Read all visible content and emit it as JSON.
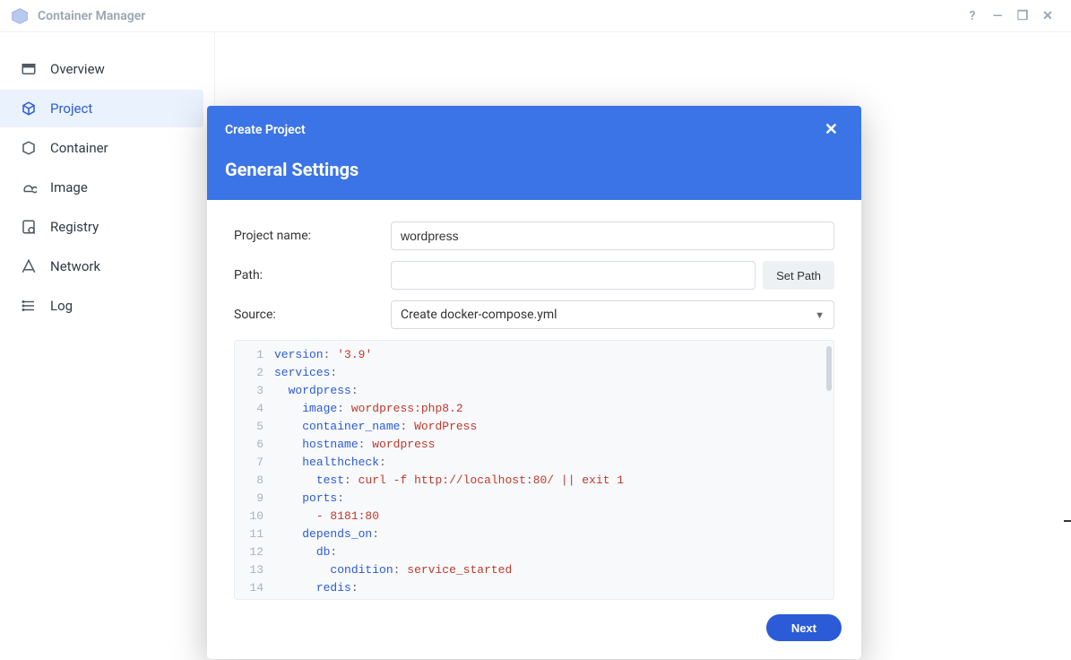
{
  "app": {
    "title": "Container Manager"
  },
  "window_controls": {
    "help": "?",
    "minimize": "—",
    "maximize": "❐",
    "close": "✕"
  },
  "sidebar": {
    "items": [
      {
        "id": "overview",
        "label": "Overview"
      },
      {
        "id": "project",
        "label": "Project",
        "active": true
      },
      {
        "id": "container",
        "label": "Container"
      },
      {
        "id": "image",
        "label": "Image"
      },
      {
        "id": "registry",
        "label": "Registry"
      },
      {
        "id": "network",
        "label": "Network"
      },
      {
        "id": "log",
        "label": "Log"
      }
    ]
  },
  "modal": {
    "title": "Create Project",
    "section": "General Settings",
    "labels": {
      "projectName": "Project name:",
      "path": "Path:",
      "source": "Source:",
      "setPath": "Set Path",
      "next": "Next"
    },
    "projectName": "wordpress",
    "path": "",
    "sourceSelected": "Create docker-compose.yml",
    "code": [
      {
        "indent": 0,
        "key": "version",
        "val": "'3.9'",
        "valType": "str"
      },
      {
        "indent": 0,
        "key": "services",
        "val": ""
      },
      {
        "indent": 1,
        "key": "wordpress",
        "val": ""
      },
      {
        "indent": 2,
        "key": "image",
        "val": "wordpress:php8.2",
        "valType": "str"
      },
      {
        "indent": 2,
        "key": "container_name",
        "val": "WordPress",
        "valType": "str"
      },
      {
        "indent": 2,
        "key": "hostname",
        "val": "wordpress",
        "valType": "str"
      },
      {
        "indent": 2,
        "key": "healthcheck",
        "val": ""
      },
      {
        "indent": 3,
        "key": "test",
        "val": "curl -f http://localhost:80/ || exit 1",
        "valType": "str"
      },
      {
        "indent": 2,
        "key": "ports",
        "val": ""
      },
      {
        "indent": 3,
        "raw": "- 8181:80",
        "valType": "num"
      },
      {
        "indent": 2,
        "key": "depends_on",
        "val": ""
      },
      {
        "indent": 3,
        "key": "db",
        "val": ""
      },
      {
        "indent": 4,
        "key": "condition",
        "val": "service_started",
        "valType": "str"
      },
      {
        "indent": 3,
        "key": "redis",
        "val": ""
      }
    ]
  }
}
